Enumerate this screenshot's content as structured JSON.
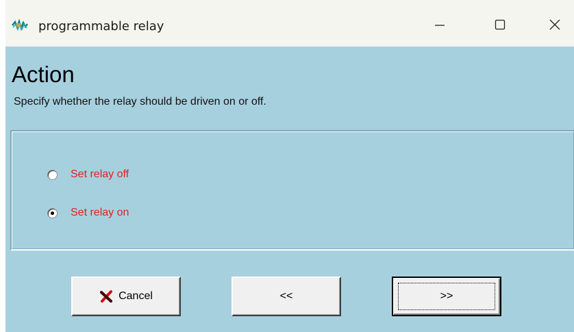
{
  "window": {
    "title": "programmable relay",
    "background": "#a7d0df"
  },
  "titlebar": {
    "app_icon": "relay-app-icon",
    "minimize_icon": "minimize-icon",
    "maximize_icon": "maximize-icon",
    "close_icon": "close-icon"
  },
  "page": {
    "heading": "Action",
    "subtitle": "Specify whether the relay should be driven on or off."
  },
  "options": [
    {
      "label": "Set relay off",
      "checked": false
    },
    {
      "label": "Set relay on",
      "checked": true
    }
  ],
  "buttons": {
    "cancel": {
      "label": "Cancel",
      "icon": "red-x-icon"
    },
    "back": {
      "label": "<<"
    },
    "next": {
      "label": ">>"
    }
  },
  "colors": {
    "option_text": "#e02020",
    "cancel_icon": "#cc1111"
  }
}
